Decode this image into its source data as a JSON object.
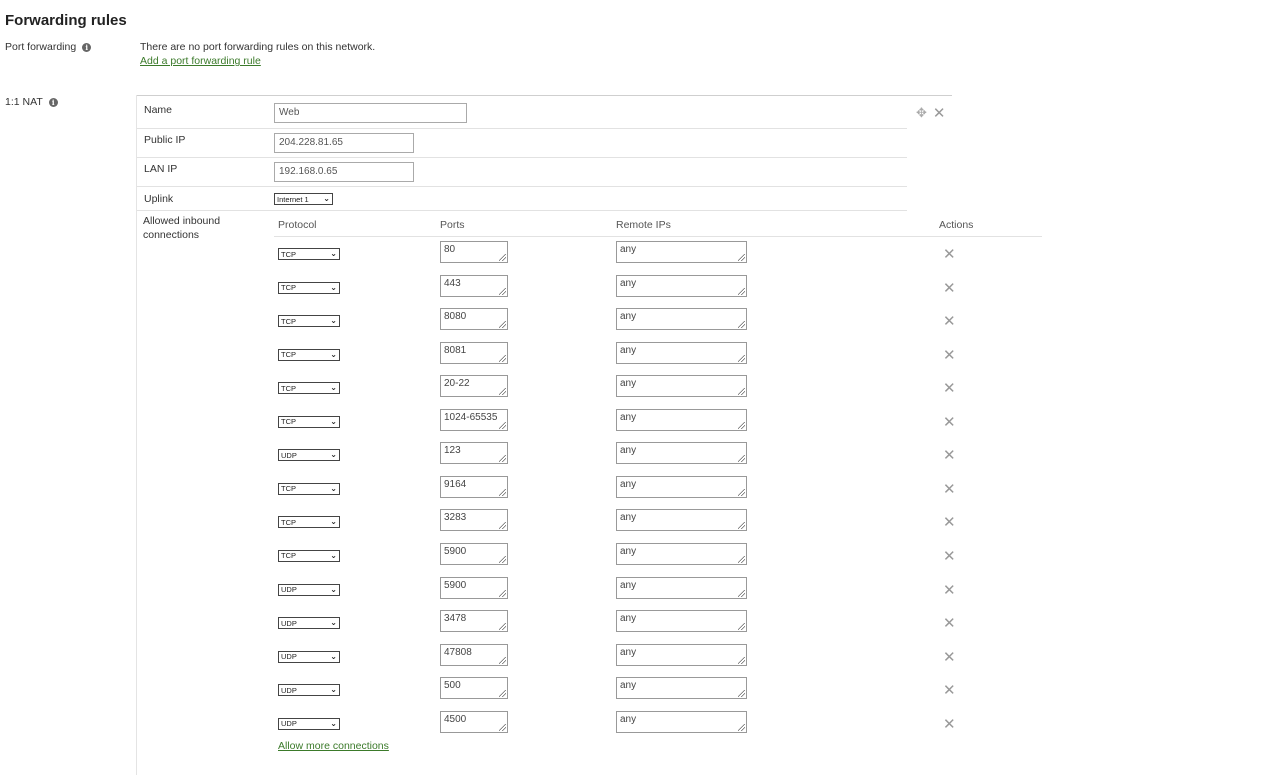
{
  "page": {
    "title": "Forwarding rules"
  },
  "port_forwarding": {
    "label": "Port forwarding",
    "info_icon": "info-icon",
    "message": "There are no port forwarding rules on this network.",
    "add_link": "Add a port forwarding rule"
  },
  "nat": {
    "label": "1:1 NAT",
    "info_icon": "info-icon",
    "name": {
      "label": "Name",
      "value": "Web"
    },
    "public_ip": {
      "label": "Public IP",
      "value": "204.228.81.65"
    },
    "lan_ip": {
      "label": "LAN IP",
      "value": "192.168.0.65"
    },
    "uplink": {
      "label": "Uplink",
      "value": "Internet 1"
    },
    "allowed": {
      "label": "Allowed inbound connections",
      "headers": {
        "protocol": "Protocol",
        "ports": "Ports",
        "remote_ips": "Remote IPs",
        "actions": "Actions"
      },
      "rows": [
        {
          "protocol": "TCP",
          "ports": "80",
          "remote": "any"
        },
        {
          "protocol": "TCP",
          "ports": "443",
          "remote": "any"
        },
        {
          "protocol": "TCP",
          "ports": "8080",
          "remote": "any"
        },
        {
          "protocol": "TCP",
          "ports": "8081",
          "remote": "any"
        },
        {
          "protocol": "TCP",
          "ports": "20-22",
          "remote": "any"
        },
        {
          "protocol": "TCP",
          "ports": "1024-65535",
          "remote": "any"
        },
        {
          "protocol": "UDP",
          "ports": "123",
          "remote": "any"
        },
        {
          "protocol": "TCP",
          "ports": "9164",
          "remote": "any"
        },
        {
          "protocol": "TCP",
          "ports": "3283",
          "remote": "any"
        },
        {
          "protocol": "TCP",
          "ports": "5900",
          "remote": "any"
        },
        {
          "protocol": "UDP",
          "ports": "5900",
          "remote": "any"
        },
        {
          "protocol": "UDP",
          "ports": "3478",
          "remote": "any"
        },
        {
          "protocol": "UDP",
          "ports": "47808",
          "remote": "any"
        },
        {
          "protocol": "UDP",
          "ports": "500",
          "remote": "any"
        },
        {
          "protocol": "UDP",
          "ports": "4500",
          "remote": "any"
        }
      ],
      "allow_more": "Allow more connections"
    },
    "icons": {
      "move": "move-icon",
      "close": "close-icon",
      "delete_row": "close-icon"
    }
  },
  "colors": {
    "link": "#3b7a2a",
    "border": "#e2e2e2"
  }
}
